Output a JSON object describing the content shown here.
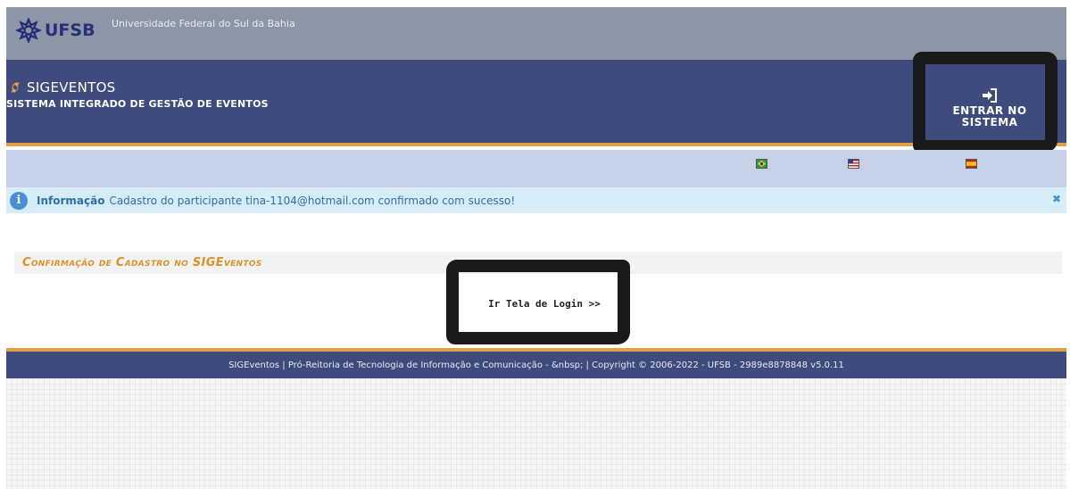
{
  "top_bar": {
    "logo_text": "UFSB",
    "university_name": "Universidade Federal do Sul da Bahia"
  },
  "header": {
    "brand_title": "SIGEVENTOS",
    "brand_subtitle": "SISTEMA INTEGRADO DE GESTÃO DE EVENTOS",
    "login_label_line1": "ENTRAR NO",
    "login_label_line2": "SISTEMA",
    "login_icon": "sign-in-icon"
  },
  "languages": [
    {
      "name": "brazil-flag-icon"
    },
    {
      "name": "usa-flag-icon"
    },
    {
      "name": "spain-flag-icon"
    }
  ],
  "info_message": {
    "label": "Informação",
    "text": "Cadastro do participante tina-1104@hotmail.com confirmado com sucesso!",
    "close": "✖"
  },
  "panel": {
    "title": "Confirmação de Cadastro no SIGEventos",
    "link_label": "Ir Tela de Login >>"
  },
  "footer": {
    "text": "SIGEventos | Pró-Reitoria de Tecnologia de Informação e Comunicação - &nbsp; | Copyright © 2006-2022 - UFSB - 2989e8878848 v5.0.11"
  },
  "colors": {
    "top_bar": "#8d96a6",
    "header": "#3f4b7c",
    "accent": "#e0a04a",
    "lang_bar": "#c6d1e8",
    "info_bg": "#d6ecf6"
  }
}
